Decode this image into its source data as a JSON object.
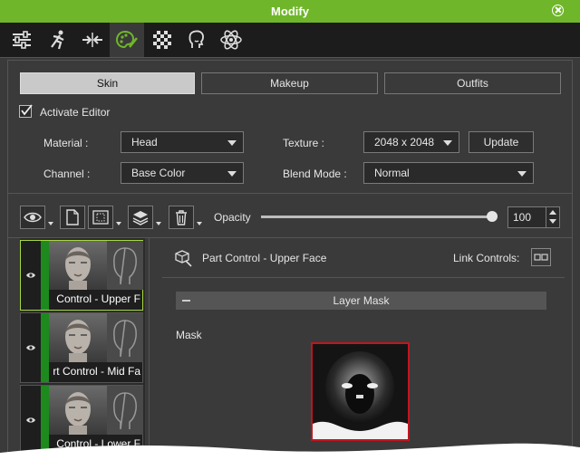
{
  "window": {
    "title": "Modify"
  },
  "toolbar_icons": [
    "sliders-icon",
    "motion-icon",
    "transform-icon",
    "material-icon",
    "checker-icon",
    "face-icon",
    "atom-icon"
  ],
  "tabs": [
    {
      "label": "Skin",
      "selected": true
    },
    {
      "label": "Makeup",
      "selected": false
    },
    {
      "label": "Outfits",
      "selected": false
    }
  ],
  "activate_editor": {
    "label": "Activate Editor",
    "checked": true
  },
  "material": {
    "label": "Material :",
    "value": "Head"
  },
  "texture": {
    "label": "Texture :",
    "value": "2048 x 2048",
    "update_label": "Update"
  },
  "channel": {
    "label": "Channel :",
    "value": "Base Color"
  },
  "blend_mode": {
    "label": "Blend Mode :",
    "value": "Normal"
  },
  "opacity": {
    "label": "Opacity",
    "value": "100",
    "level": 1.0
  },
  "layers": [
    {
      "name": "Control - Upper F",
      "selected": true
    },
    {
      "name": "rt Control - Mid Fa",
      "selected": false
    },
    {
      "name": "Control - Lower F",
      "selected": false
    }
  ],
  "part_control": {
    "title": "Part Control - Upper Face",
    "link_label": "Link Controls:"
  },
  "layer_mask": {
    "section_title": "Layer Mask",
    "mask_label": "Mask"
  },
  "colors": {
    "accent_green": "#6fb62a",
    "layer_green": "#1d8a1d",
    "mask_border": "#c0161f"
  }
}
